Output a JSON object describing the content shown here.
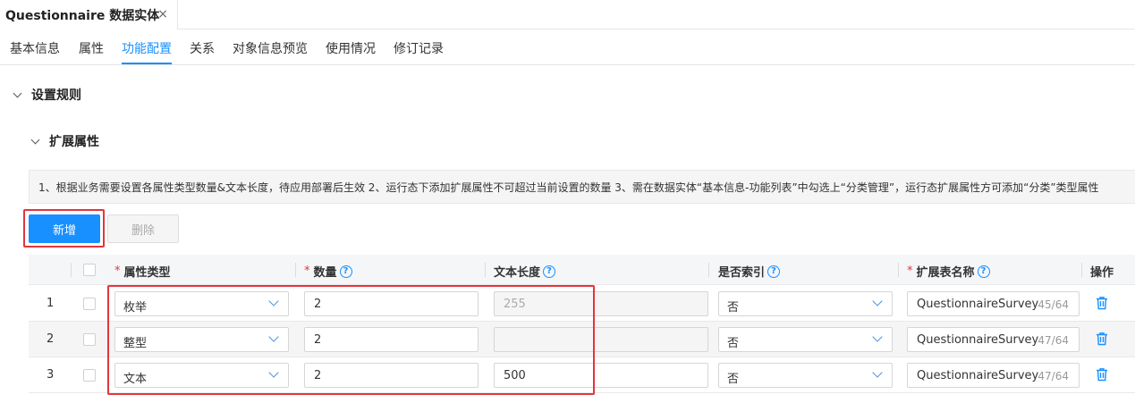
{
  "doc_tab": {
    "title": "Questionnaire 数据实体",
    "close": "×"
  },
  "subtabs": [
    "基本信息",
    "属性",
    "功能配置",
    "关系",
    "对象信息预览",
    "使用情况",
    "修订记录"
  ],
  "sections": {
    "rules": "设置规则",
    "ext_attrs": "扩展属性"
  },
  "notice": "1、根据业务需要设置各属性类型数量&文本长度，待应用部署后生效 2、运行态下添加扩展属性不可超过当前设置的数量 3、需在数据实体“基本信息-功能列表”中勾选上“分类管理”，运行态扩展属性方可添加“分类”类型属性",
  "buttons": {
    "add": "新增",
    "delete": "删除"
  },
  "table": {
    "required_mark": "*",
    "help_mark": "?",
    "headers": {
      "type": "属性类型",
      "count": "数量",
      "length": "文本长度",
      "index": "是否索引",
      "ext_table": "扩展表名称",
      "ops": "操作"
    },
    "rows": [
      {
        "num": "1",
        "type": "枚举",
        "count": "2",
        "length": "255",
        "index": "否",
        "ext_table": "QuestionnaireSurvey",
        "ext_count": "45/64"
      },
      {
        "num": "2",
        "type": "整型",
        "count": "2",
        "length": "",
        "index": "否",
        "ext_table": "QuestionnaireSurvey",
        "ext_count": "47/64"
      },
      {
        "num": "3",
        "type": "文本",
        "count": "2",
        "length": "500",
        "index": "否",
        "ext_table": "QuestionnaireSurvey",
        "ext_count": "47/64"
      }
    ]
  },
  "colors": {
    "accent": "#1890ff",
    "highlight": "#e5343b"
  },
  "icons": {
    "collapse": "chevron-down-icon",
    "help": "question-circle-icon",
    "delete": "trash-icon"
  }
}
